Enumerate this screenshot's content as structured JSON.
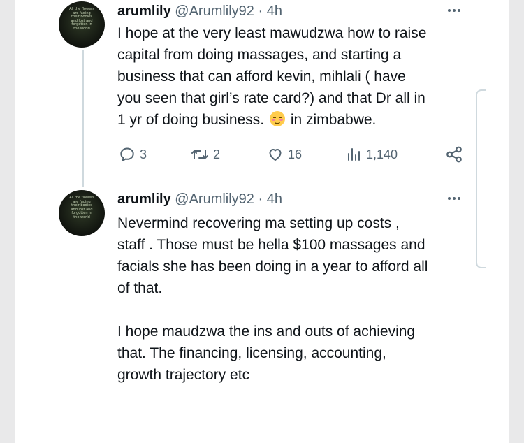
{
  "tweets": [
    {
      "avatar_text": "All the flowers are fading their bodies and lost and forgotten in the world",
      "name": "arumlily",
      "handle": "@Arumlily92",
      "separator": "·",
      "time": "4h",
      "lines": [
        "I hope at the very least mawudzwa how to raise",
        "capital from doing massages, and starting a",
        "business that can afford kevin, mihlali ( have",
        "you seen that girl’s rate card?) and that Dr all in"
      ],
      "last_line_before_emoji": "1 yr of doing business.",
      "emoji": "smiling-face-with-blush-emoji",
      "last_line_after_emoji": "in zimbabwe.",
      "stats": {
        "replies": "3",
        "retweets": "2",
        "likes": "16",
        "views": "1,140"
      }
    },
    {
      "avatar_text": "All the flowers are fading their bodies and lost and forgotten in the world",
      "name": "arumlily",
      "handle": "@Arumlily92",
      "separator": "·",
      "time": "4h",
      "paragraph1": [
        "Nevermind recovering ma setting up costs ,",
        "staff . Those must be hella $100 massages and",
        "facials she has been doing in a year to afford all",
        "of that."
      ],
      "paragraph2": [
        "I hope maudzwa the ins and outs of achieving",
        "that. The financing, licensing, accounting,",
        "growth trajectory etc"
      ]
    }
  ],
  "colors": {
    "text": "#0f1419",
    "secondary": "#536471",
    "divider": "#cfd9de"
  }
}
